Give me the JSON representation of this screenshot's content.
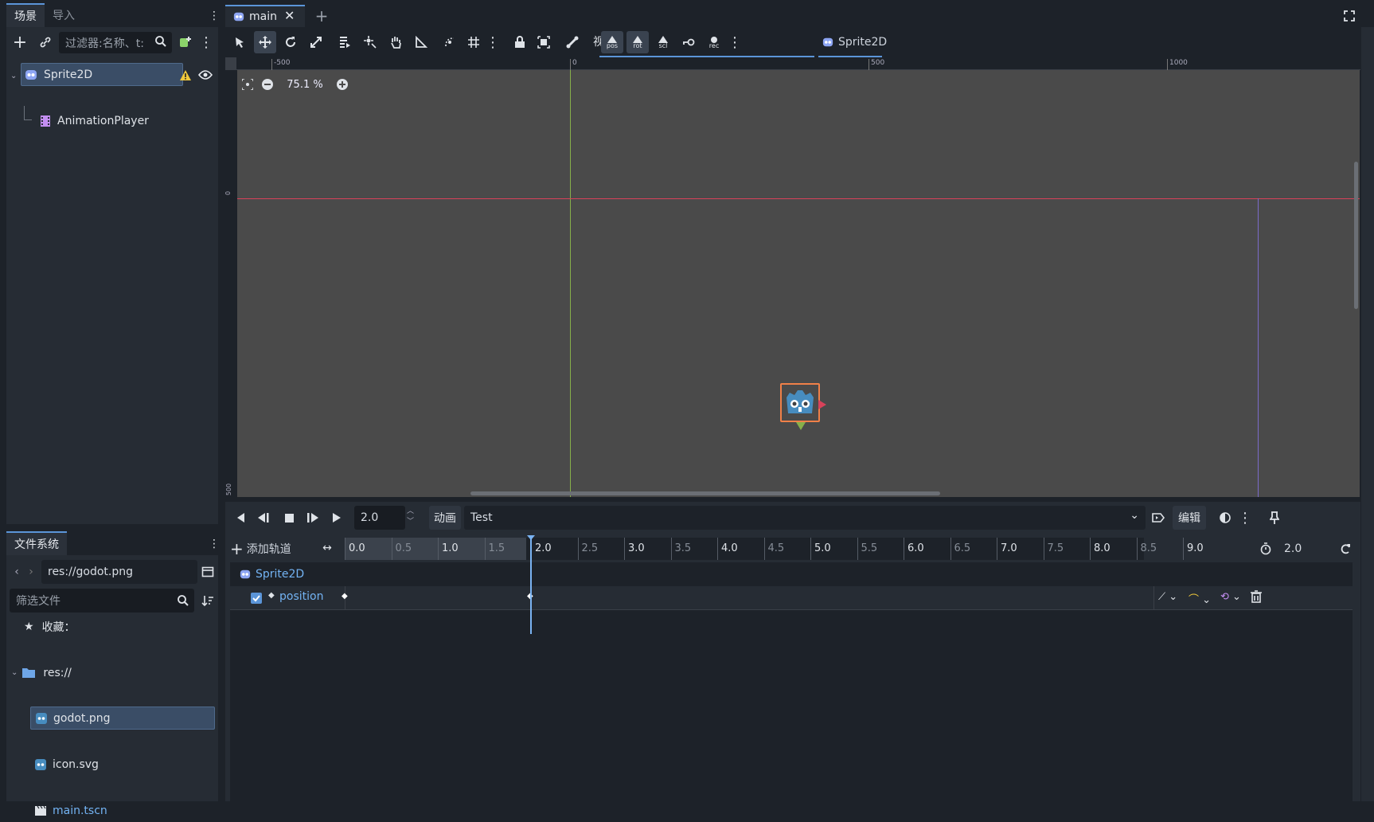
{
  "scene_dock": {
    "tab_scene": "场景",
    "tab_import": "导入",
    "filter_placeholder": "过滤器:名称、t:",
    "nodes": [
      {
        "name": "Sprite2D"
      },
      {
        "name": "AnimationPlayer"
      }
    ]
  },
  "filesystem": {
    "tab": "文件系统",
    "path": "res://godot.png",
    "filter_placeholder": "筛选文件",
    "favorites": "收藏：",
    "root": "res://",
    "files": [
      {
        "name": "godot.png",
        "selected": true
      },
      {
        "name": "icon.svg"
      },
      {
        "name": "main.tscn"
      }
    ]
  },
  "editor_tabs": {
    "main": "main",
    "add": "+"
  },
  "toolbar": {
    "view_label": "视图",
    "node_label": "Sprite2D",
    "pos": "pos",
    "rot": "rot",
    "scl": "scl",
    "rec": "rec"
  },
  "viewport": {
    "zoom": "75.1 %",
    "ruler_top": [
      "-500",
      "0",
      "500",
      "1000"
    ],
    "ruler_left": [
      "0",
      "500"
    ]
  },
  "animation": {
    "time": "2.0",
    "anim_label": "动画",
    "anim_name": "Test",
    "edit_label": "编辑",
    "add_track": "添加轨道",
    "timeline": [
      "0.0",
      "0.5",
      "1.0",
      "1.5",
      "2.0",
      "2.5",
      "3.0",
      "3.5",
      "4.0",
      "4.5",
      "5.0",
      "5.5",
      "6.0",
      "6.5",
      "7.0",
      "7.5",
      "8.0",
      "8.5",
      "9.0"
    ],
    "length": "2.0",
    "track_node": "Sprite2D",
    "track_property": "position",
    "cursor_time": 2.0
  },
  "colors": {
    "accent": "#5b95d8",
    "bg": "#1d2229",
    "panel": "#262c34",
    "viewport": "#4a4a4a",
    "x_axis": "#d8425a",
    "y_axis": "#87b04a"
  }
}
